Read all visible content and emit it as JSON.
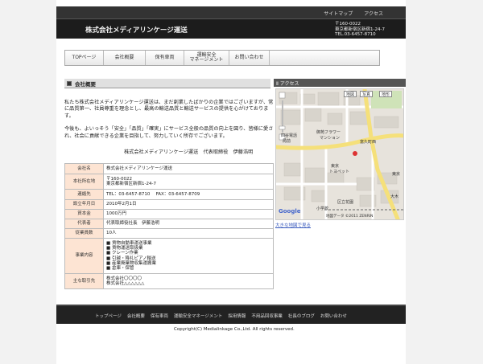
{
  "header": {
    "links": [
      "サイトマップ",
      "アクセス"
    ],
    "company_name": "株式会社メディアリンケージ運送",
    "address_lines": [
      "〒160-0022",
      "東京都新宿区新宿1-24-7",
      "TEL.03-6457-8710"
    ]
  },
  "nav": {
    "items": [
      {
        "label": "TOPページ"
      },
      {
        "label": "会社概要"
      },
      {
        "label": "保有車両"
      },
      {
        "label": "運輸安全\nマネージメント"
      },
      {
        "label": "お問い合わせ"
      }
    ]
  },
  "main": {
    "section_title": "会社概要",
    "intro_paragraphs": [
      "私たち株式会社メディアリンケージ運送は、まだ創業したばかりの企業ではございますが、常に品質第一、社員尊重を理念とし、最高の輸送品質と輸送サービスの提供を心がけております。",
      "今後も、よいっそう「安全」「品質」「確実」にサービス全般の品質の向上を図り、皆様に愛され、社会に貢献できる企業を目指して、努力していく所存でございます。"
    ],
    "signature": "株式会社メディアリンケージ運送　代表取締役　伊藤浩明",
    "table": [
      {
        "key": "会社名",
        "value": [
          "株式会社メディアリンケージ運送"
        ]
      },
      {
        "key": "本社所在地",
        "value": [
          "〒160-0022",
          "東京都新宿区新宿1-24-7"
        ]
      },
      {
        "key": "連絡先",
        "value": [
          "TEL：03-6457-8710　 FAX：03-6457-8709"
        ]
      },
      {
        "key": "設立年月日",
        "value": [
          "2010年2月1日"
        ]
      },
      {
        "key": "資本金",
        "value": [
          "1000万円"
        ]
      },
      {
        "key": "代表者",
        "value": [
          "代表取締役社長　伊藤浩明"
        ]
      },
      {
        "key": "従業員数",
        "value": [
          "10人"
        ]
      },
      {
        "key": "事業内容",
        "value": [
          "■ 貨物自動車運送事業",
          "■ 貨物運送取扱業",
          "■ クレーン作業",
          "■ 引越・降礼ピアノ輸送",
          "■ 産業廃棄物収集運搬業",
          "■ 倉庫・保管"
        ]
      },
      {
        "key": "主な取引先",
        "value": [
          "株式会社〇〇〇〇",
          "株式会社△△△△△△"
        ]
      }
    ]
  },
  "access": {
    "title": "Ⅱ アクセス",
    "map_controls": [
      "地図",
      "写真",
      "地形"
    ],
    "map_labels": [
      "四谷電話",
      "局前",
      "御苑フラワー",
      "マンション",
      "富久町西",
      "東京",
      "トヨペット",
      "区立花園",
      "小学校",
      "東京",
      "大木",
      "Google",
      "地図データ ©2011 ZENRIN"
    ],
    "larger_map_link": "大きな地図で見る"
  },
  "footer": {
    "links": [
      "トップページ",
      "会社概要",
      "保有車両",
      "運輸安全マネージメント",
      "採用情報",
      "不用品回収事業",
      "社長のブログ",
      "お問い合わせ"
    ],
    "copyright": "Copyright(C) Medialinkage Co.,Ltd.  All rights reserved."
  },
  "colors": {
    "header_bg": "#1c1c1c",
    "table_key_bg": "#fde4d3",
    "link_blue": "#3355bb",
    "map_road_yellow": "#f5e07a"
  }
}
